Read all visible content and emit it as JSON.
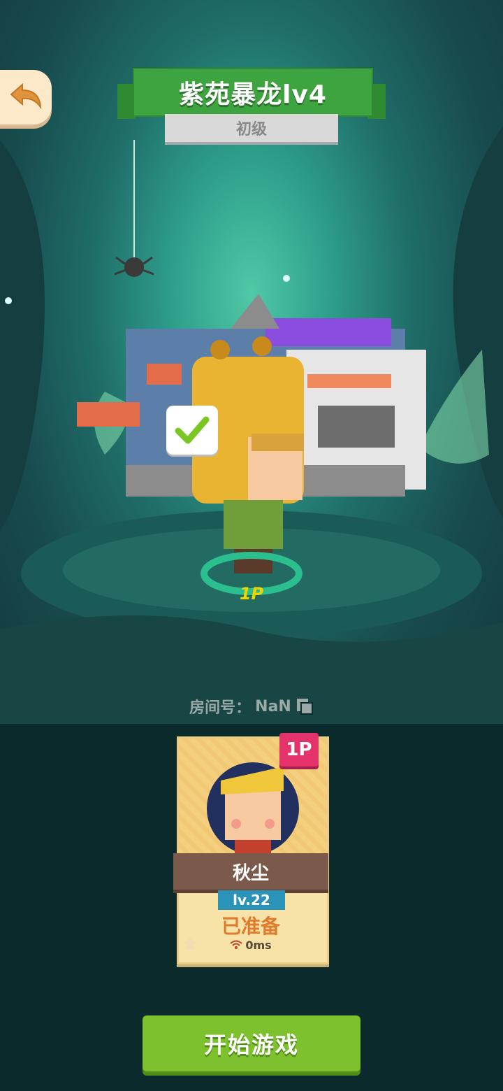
{
  "header": {
    "title": "紫苑暴龙lv4",
    "difficulty": "初级"
  },
  "icons": {
    "back": "back-arrow-icon",
    "check": "checkmark-icon",
    "copy": "copy-icon",
    "wifi": "wifi-icon",
    "home": "home-icon"
  },
  "scene": {
    "player_marker": "1P"
  },
  "room": {
    "label": "房间号：",
    "value": "NaN"
  },
  "player_card": {
    "slot": "1P",
    "name": "秋尘",
    "level": "lv.22",
    "status": "已准备",
    "ping": "0ms"
  },
  "start_button": {
    "label": "开始游戏"
  },
  "colors": {
    "title_green": "#3da43f",
    "start_green": "#7dc12e",
    "badge_pink": "#e4336b",
    "level_blue": "#2a93b7",
    "ready_orange": "#e07a2c"
  }
}
